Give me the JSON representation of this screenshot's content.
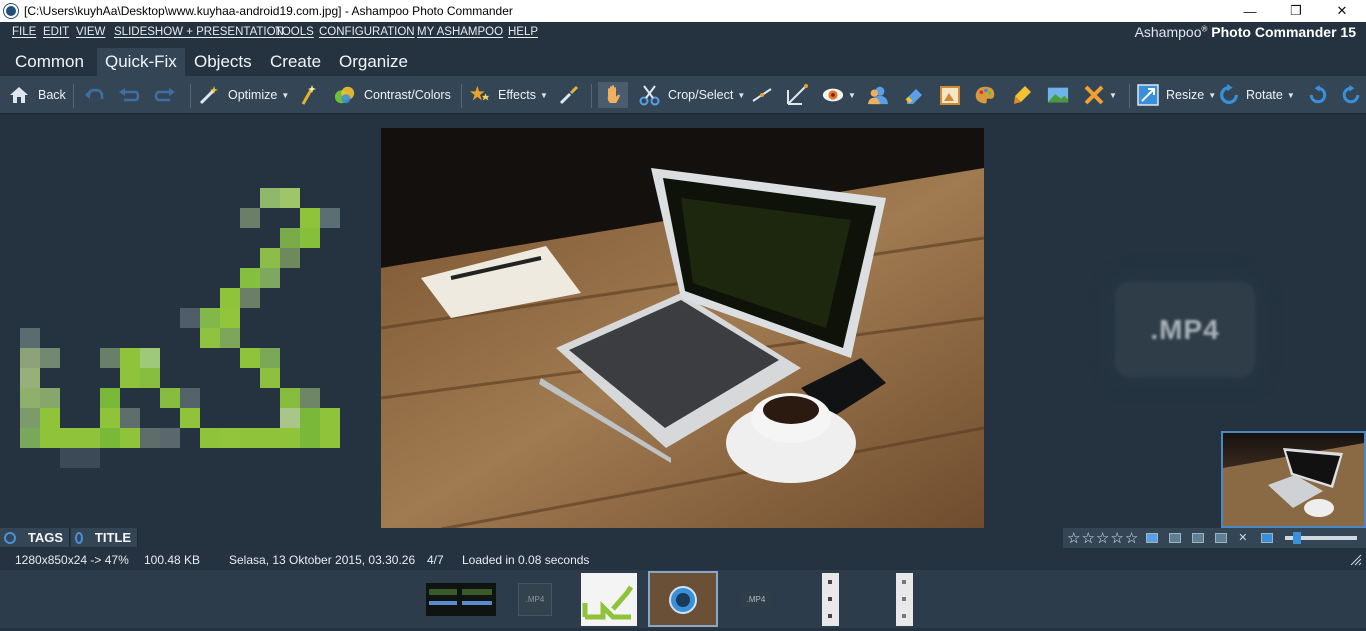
{
  "window": {
    "title": "[C:\\Users\\kuyhAa\\Desktop\\www.kuyhaa-android19.com.jpg] - Ashampoo Photo Commander",
    "minimize_glyph": "—",
    "maximize_glyph": "❐",
    "close_glyph": "✕"
  },
  "menu": {
    "items": [
      "FILE",
      "EDIT",
      "VIEW",
      "SLIDESHOW + PRESENTATION",
      "TOOLS",
      "CONFIGURATION",
      "MY ASHAMPOO",
      "HELP"
    ],
    "brand_prefix": "Ashampoo",
    "brand_reg": "®",
    "brand_name": "Photo Commander 15"
  },
  "tabs": [
    "Common",
    "Quick-Fix",
    "Objects",
    "Create",
    "Organize"
  ],
  "active_tab": "Quick-Fix",
  "toolbar": {
    "back": "Back",
    "optimize": "Optimize",
    "contrast": "Contrast/Colors",
    "effects": "Effects",
    "crop": "Crop/Select",
    "resize": "Resize",
    "rotate": "Rotate"
  },
  "viewer": {
    "side_label": ".MP4"
  },
  "tags_bar": {
    "tags": "TAGS",
    "title": "TITLE"
  },
  "status": {
    "dimensions": "1280x850x24 -> 47%",
    "filesize": "100.48 KB",
    "date": "Selasa, 13 Oktober 2015, 03.30.26",
    "position": "4/7",
    "load_time": "Loaded in 0.08 seconds"
  },
  "filmstrip": {
    "mp4_label": ".MP4"
  },
  "colors": {
    "background": "#253341",
    "toolbar": "#344656",
    "accent": "#4a90d9",
    "logo_green": "#7ab83a"
  },
  "icons": [
    "app-icon",
    "home-icon",
    "undo-icon",
    "redo-icon",
    "wand-icon",
    "contrast-icon",
    "effects-star-icon",
    "brush-icon",
    "hand-icon",
    "scissors-icon",
    "line-icon",
    "perspective-icon",
    "red-eye-icon",
    "portrait-icon",
    "eraser-icon",
    "frame-icon",
    "palette-icon",
    "paint-brush-icon",
    "landscape-icon",
    "tools-cross-icon",
    "resize-icon",
    "rotate-icon",
    "rotate-ccw-icon",
    "rotate-cw-icon"
  ]
}
